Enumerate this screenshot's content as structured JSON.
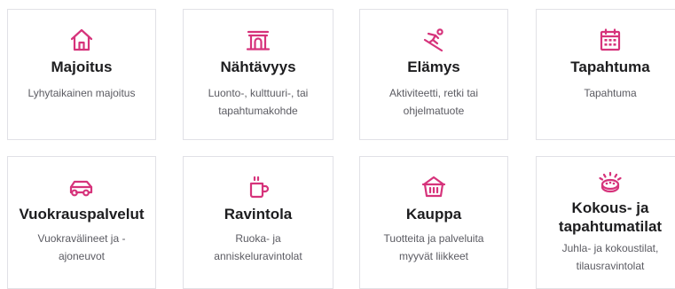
{
  "accent_color": "#d6337b",
  "categories": [
    {
      "title": "Majoitus",
      "description": "Lyhytaikainen majoitus",
      "icon": "house-icon"
    },
    {
      "title": "Nähtävyys",
      "description": "Luonto-, kulttuuri-, tai tapahtumakohde",
      "icon": "monument-gate-icon"
    },
    {
      "title": "Elämys",
      "description": "Aktiviteetti, retki tai ohjelmatuote",
      "icon": "skier-icon"
    },
    {
      "title": "Tapahtuma",
      "description": "Tapahtuma",
      "icon": "calendar-icon"
    },
    {
      "title": "Vuokrauspalvelut",
      "description": "Vuokravälineet ja -ajoneuvot",
      "icon": "car-icon"
    },
    {
      "title": "Ravintola",
      "description": "Ruoka- ja anniskeluravintolat",
      "icon": "coffee-mug-icon"
    },
    {
      "title": "Kauppa",
      "description": "Tuotteita ja palveluita myyvät liikkeet",
      "icon": "shopping-basket-icon"
    },
    {
      "title": "Kokous- ja tapahtumatilat",
      "description": "Juhla- ja kokoustilat, tilausravintolat",
      "icon": "conference-table-icon"
    }
  ]
}
